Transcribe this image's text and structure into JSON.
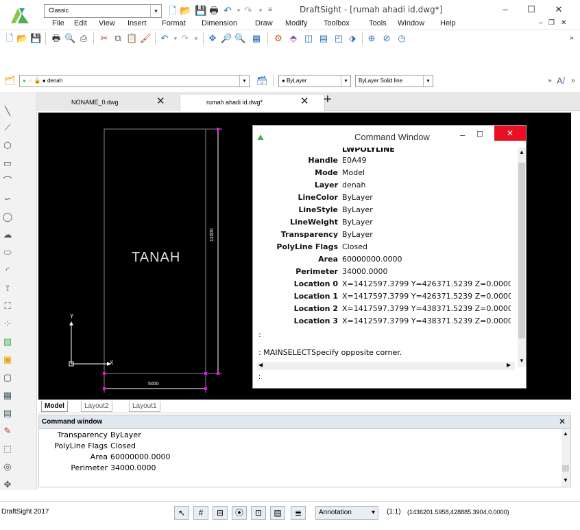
{
  "app": {
    "workspace": "Classic",
    "window_title": "DraftSight - [rumah ahadi id.dwg*]"
  },
  "menu": [
    "File",
    "Edit",
    "View",
    "Insert",
    "Format",
    "Dimension",
    "Draw",
    "Modify",
    "Toolbox",
    "Tools",
    "Window",
    "Help"
  ],
  "layer_toolbar": {
    "layer": "denah",
    "color": "ByLayer",
    "linestyle_prefix": "ByLayer",
    "linestyle": "Solid line"
  },
  "doc_tabs": [
    {
      "label": "NONAME_0.dwg"
    },
    {
      "label": "rumah ahadi id.dwg*"
    }
  ],
  "drawing": {
    "center_text": "TANAH",
    "dim_vertical": "12000",
    "dim_horizontal": "5000",
    "ucs_x": "X",
    "ucs_y": "Y"
  },
  "cmd_window": {
    "title": "Command Window",
    "header_partial": "LWPOLYLINE",
    "properties": [
      {
        "name": "Handle",
        "value": "E0A49"
      },
      {
        "name": "Mode",
        "value": "Model"
      },
      {
        "name": "Layer",
        "value": "denah"
      },
      {
        "name": "LineColor",
        "value": "ByLayer"
      },
      {
        "name": "LineStyle",
        "value": "ByLayer"
      },
      {
        "name": "LineWeight",
        "value": "ByLayer"
      },
      {
        "name": "Transparency",
        "value": "ByLayer"
      },
      {
        "name": "PolyLine Flags",
        "value": "Closed"
      },
      {
        "name": "Area",
        "value": "60000000.0000"
      },
      {
        "name": "Perimeter",
        "value": "34000.0000"
      },
      {
        "name": "Location 0",
        "value": "X=1412597.3799 Y=426371.5239 Z=0.0000"
      },
      {
        "name": "Location 1",
        "value": "X=1417597.3799 Y=426371.5239 Z=0.0000"
      },
      {
        "name": "Location 2",
        "value": "X=1417597.3799 Y=438371.5239 Z=0.0000"
      },
      {
        "name": "Location 3",
        "value": "X=1412597.3799 Y=438371.5239 Z=0.0000"
      }
    ],
    "colon_line": ":",
    "prompt_line": ": MAINSELECTSpecify opposite corner.",
    "input_line": ":"
  },
  "layout_tabs": [
    "Model",
    "Layout2",
    "Layout1"
  ],
  "bottom_cmd": {
    "title": "Command window",
    "properties": [
      {
        "name": "Transparency",
        "value": "ByLayer"
      },
      {
        "name": "PolyLine Flags",
        "value": "Closed"
      },
      {
        "name": "Area",
        "value": "60000000.0000"
      },
      {
        "name": "Perimeter",
        "value": "34000.0000"
      }
    ]
  },
  "status": {
    "app_version": "DraftSight 2017",
    "annotation": "Annotation",
    "scale": "(1:1)",
    "coordinates": "(1436201.5958,428885.3904,0.0000)"
  },
  "colors": {
    "canvas": "#000000",
    "grip_magenta": "#ff00ff",
    "entity_white": "#ffffff",
    "close_red": "#e81123"
  }
}
